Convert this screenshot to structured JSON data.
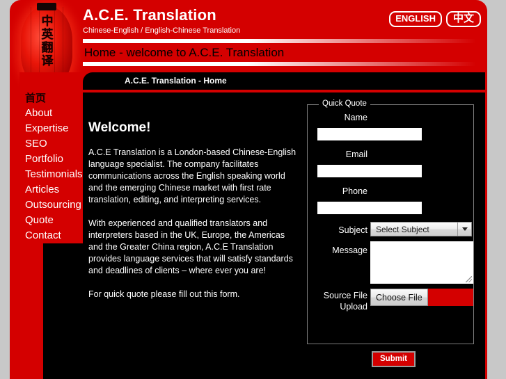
{
  "brand": {
    "title": "A.C.E. Translation",
    "subtitle": "Chinese-English / English-Chinese Translation",
    "logo_characters": "中英翻译"
  },
  "lang_switch": {
    "english_label": "ENGLISH",
    "chinese_label": "中文"
  },
  "page_title": "Home - welcome to A.C.E. Translation",
  "tab": {
    "label": "A.C.E. Translation - Home"
  },
  "sidebar": {
    "items": [
      {
        "label": "首页"
      },
      {
        "label": "About"
      },
      {
        "label": "Expertise"
      },
      {
        "label": "SEO"
      },
      {
        "label": "Portfolio"
      },
      {
        "label": "Testimonials"
      },
      {
        "label": "Articles"
      },
      {
        "label": "Outsourcing"
      },
      {
        "label": "Quote"
      },
      {
        "label": "Contact"
      }
    ]
  },
  "welcome": {
    "heading": "Welcome!",
    "paragraphs": [
      "A.C.E Translation is a London-based Chinese-English language specialist. The company facilitates communications across the English speaking world and the emerging Chinese market with first rate translation, editing, and interpreting services.",
      "With experienced and qualified translators and interpreters based in the UK, Europe, the Americas and the Greater China region, A.C.E Translation provides language services that will satisfy standards and deadlines of clients – where ever you are!",
      "For quick quote please fill out this form."
    ]
  },
  "quick_quote": {
    "legend": "Quick Quote",
    "name_label": "Name",
    "name_value": "",
    "email_label": "Email",
    "email_value": "",
    "phone_label": "Phone",
    "phone_value": "",
    "subject_label": "Subject",
    "subject_selected": "Select Subject",
    "message_label": "Message",
    "message_value": "",
    "upload_label_line1": "Source File",
    "upload_label_line2": "Upload",
    "choose_file_label": "Choose File",
    "submit_label": "Submit"
  },
  "colors": {
    "brand_red": "#d40000",
    "panel_black": "#000000",
    "page_background": "#c8c8c8",
    "text_white": "#ffffff"
  }
}
